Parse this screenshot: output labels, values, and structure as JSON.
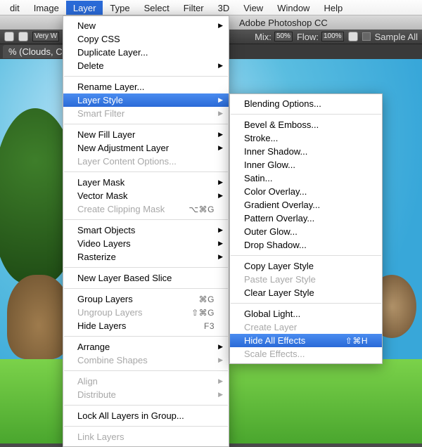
{
  "menubar": {
    "items": [
      "dit",
      "Image",
      "Layer",
      "Type",
      "Select",
      "Filter",
      "3D",
      "View",
      "Window",
      "Help"
    ],
    "selected": 2
  },
  "window": {
    "title": "Adobe Photoshop CC"
  },
  "toolbar": {
    "brush_label": "Very W",
    "mix_label": "Mix:",
    "mix_value": "50%",
    "flow_label": "Flow:",
    "flow_value": "100%",
    "sample_all": "Sample All"
  },
  "tab": {
    "label": "% (Clouds, CMYK"
  },
  "layer_menu": {
    "groups": [
      [
        {
          "l": "New",
          "a": true
        },
        {
          "l": "Copy CSS"
        },
        {
          "l": "Duplicate Layer..."
        },
        {
          "l": "Delete",
          "a": true
        }
      ],
      [
        {
          "l": "Rename Layer..."
        },
        {
          "l": "Layer Style",
          "a": true,
          "sel": true
        },
        {
          "l": "Smart Filter",
          "a": true,
          "dis": true
        }
      ],
      [
        {
          "l": "New Fill Layer",
          "a": true
        },
        {
          "l": "New Adjustment Layer",
          "a": true
        },
        {
          "l": "Layer Content Options...",
          "dis": true
        }
      ],
      [
        {
          "l": "Layer Mask",
          "a": true
        },
        {
          "l": "Vector Mask",
          "a": true
        },
        {
          "l": "Create Clipping Mask",
          "s": "⌥⌘G",
          "dis": true
        }
      ],
      [
        {
          "l": "Smart Objects",
          "a": true
        },
        {
          "l": "Video Layers",
          "a": true
        },
        {
          "l": "Rasterize",
          "a": true
        }
      ],
      [
        {
          "l": "New Layer Based Slice"
        }
      ],
      [
        {
          "l": "Group Layers",
          "s": "⌘G"
        },
        {
          "l": "Ungroup Layers",
          "s": "⇧⌘G",
          "dis": true
        },
        {
          "l": "Hide Layers",
          "s": "F3"
        }
      ],
      [
        {
          "l": "Arrange",
          "a": true
        },
        {
          "l": "Combine Shapes",
          "a": true,
          "dis": true
        }
      ],
      [
        {
          "l": "Align",
          "a": true,
          "dis": true
        },
        {
          "l": "Distribute",
          "a": true,
          "dis": true
        }
      ],
      [
        {
          "l": "Lock All Layers in Group..."
        }
      ],
      [
        {
          "l": "Link Layers",
          "dis": true
        }
      ]
    ]
  },
  "style_menu": {
    "groups": [
      [
        {
          "l": "Blending Options..."
        }
      ],
      [
        {
          "l": "Bevel & Emboss..."
        },
        {
          "l": "Stroke..."
        },
        {
          "l": "Inner Shadow..."
        },
        {
          "l": "Inner Glow..."
        },
        {
          "l": "Satin..."
        },
        {
          "l": "Color Overlay..."
        },
        {
          "l": "Gradient Overlay..."
        },
        {
          "l": "Pattern Overlay..."
        },
        {
          "l": "Outer Glow..."
        },
        {
          "l": "Drop Shadow..."
        }
      ],
      [
        {
          "l": "Copy Layer Style"
        },
        {
          "l": "Paste Layer Style",
          "dis": true
        },
        {
          "l": "Clear Layer Style"
        }
      ],
      [
        {
          "l": "Global Light..."
        },
        {
          "l": "Create Layer",
          "dis": true
        },
        {
          "l": "Hide All Effects",
          "s": "⇧⌘H",
          "sel": true
        },
        {
          "l": "Scale Effects...",
          "dis": true
        }
      ]
    ]
  }
}
